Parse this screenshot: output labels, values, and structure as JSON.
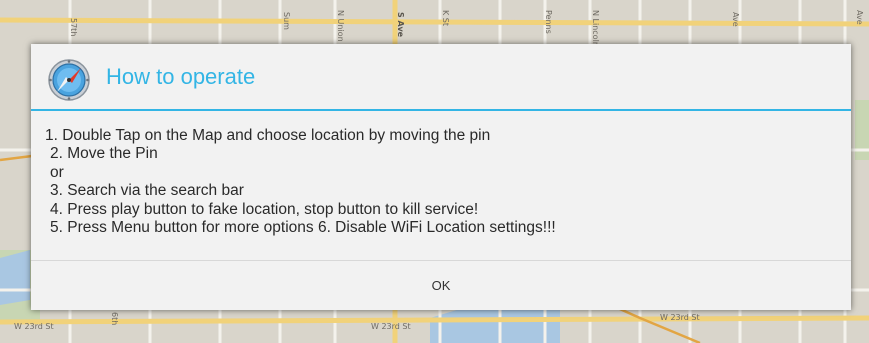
{
  "dialog": {
    "title": "How to operate",
    "icon": "compass-icon",
    "lines": [
      "1. Double Tap on the Map and choose location by moving the pin",
      "2. Move the Pin",
      "or",
      "3. Search via the search bar",
      "4. Press play button to fake location, stop button to kill service!",
      "5. Press Menu button for more options 6. Disable WiFi Location settings!!!"
    ],
    "ok_label": "OK"
  },
  "map": {
    "labels": {
      "w23_left": "W 23rd St",
      "w23_mid": "W 23rd St",
      "ave_right": "Ave",
      "s_ave": "S Ave",
      "w23_right": "W 23rd St",
      "street_57": "57th",
      "n_union": "N Union",
      "k_st": "K St",
      "penns": "Penns",
      "n_lincoln": "N Lincoln",
      "ave_small": "Ave",
      "sum": "Sum",
      "six": "6th"
    }
  },
  "colors": {
    "accent": "#33b5e5",
    "dialog_bg": "#f2f2f2",
    "map_bg": "#d6d2c8"
  }
}
